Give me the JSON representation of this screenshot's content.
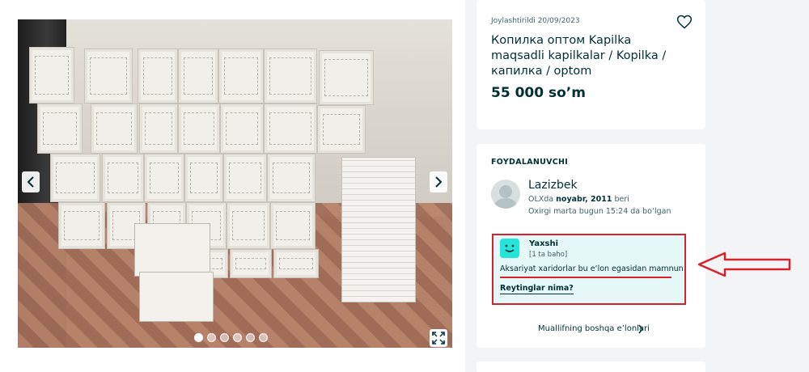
{
  "listing": {
    "posted": "Joylashtirildi 20/09/2023",
    "title": "Копилка оптом Kapilka maqsadli kapilkalar / Kopilka / капилка / optom",
    "price": "55 000 so’m"
  },
  "gallery": {
    "image_count": 6,
    "active_index": 0
  },
  "seller": {
    "section_label": "FOYDALANUVCHI",
    "name": "Lazizbek",
    "since_prefix": "OLXda ",
    "since_date": "noyabr, 2011",
    "since_suffix": " beri",
    "last_seen": "Oxirgi marta bugun 15:24 da bo‘lgan",
    "rating": {
      "label": "Yaxshi",
      "count": "[1 ta baho]",
      "description": "Aksariyat xaridorlar bu e‘lon egasidan mamnun",
      "link": "Reytinglar nima?"
    },
    "more_ads": "Muallifning boshqa e’lonlari"
  },
  "colors": {
    "accent": "#23e5db",
    "highlight_red": "#d7222b",
    "text": "#002f34"
  },
  "icons": [
    "heart-icon",
    "chevron-left-icon",
    "chevron-right-icon",
    "fullscreen-icon",
    "smile-icon",
    "chevron-right-small-icon",
    "annotation-arrow"
  ]
}
